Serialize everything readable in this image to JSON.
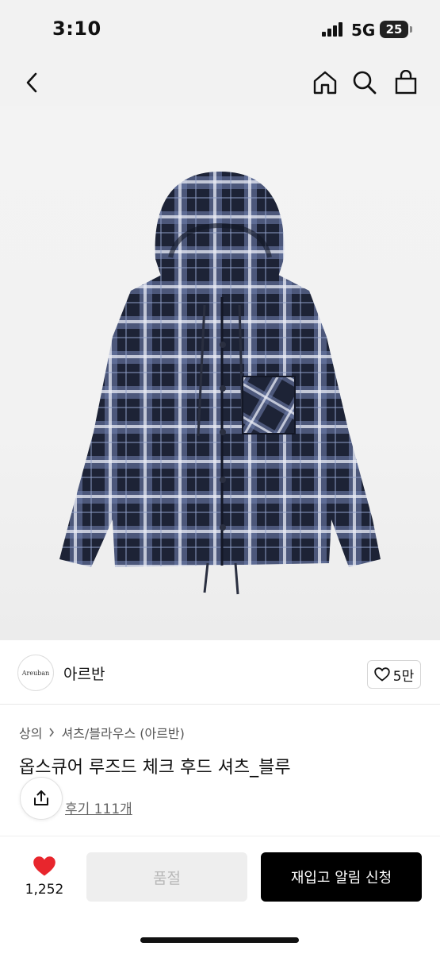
{
  "status_bar": {
    "time": "3:10",
    "network": "5G",
    "battery": "25"
  },
  "nav": {
    "back_icon": "chevron-left-icon",
    "home_icon": "home-icon",
    "search_icon": "search-icon",
    "cart_icon": "shopping-bag-icon"
  },
  "brand": {
    "logo_text": "Areuban",
    "name": "아르반",
    "likes": "5만"
  },
  "breadcrumb": {
    "level1": "상의",
    "level2": "셔츠/블라우스 (아르반)"
  },
  "product": {
    "title": "옵스큐어 루즈드 체크 후드 셔츠_블루",
    "reviews": "후기 111개"
  },
  "bottom": {
    "heart_count": "1,252",
    "soldout_label": "품절",
    "notify_label": "재입고 알림 신청"
  },
  "colors": {
    "accent": "#e8262d",
    "primary_button": "#000000",
    "disabled_button": "#eeeeee"
  }
}
